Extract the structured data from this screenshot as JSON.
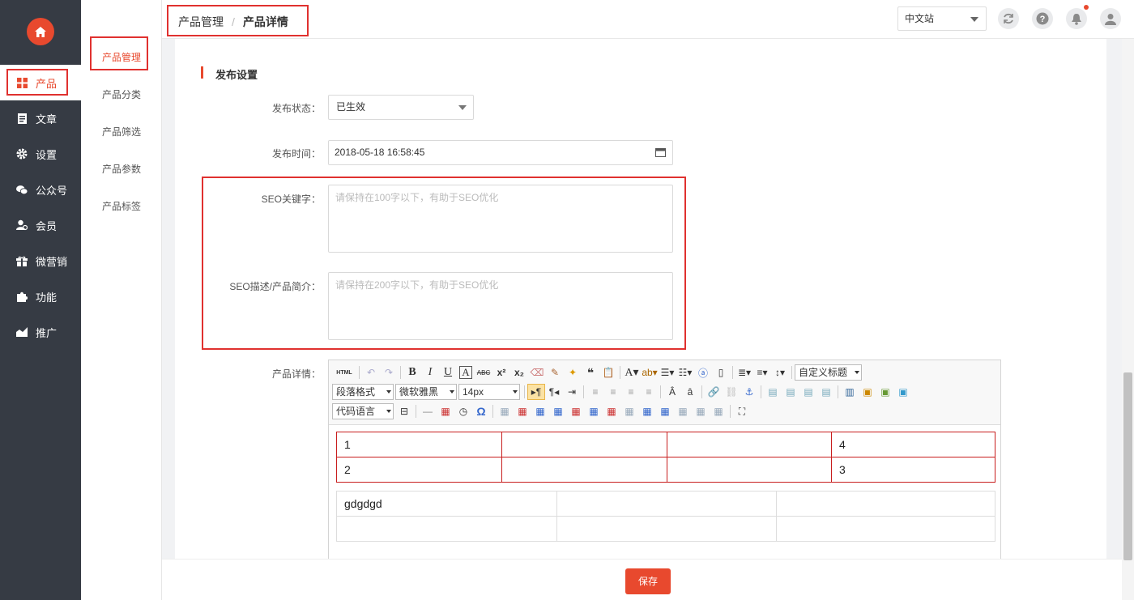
{
  "sidebar": {
    "items": [
      {
        "label": "产品",
        "icon": "grid-icon",
        "active": true
      },
      {
        "label": "文章",
        "icon": "document-icon"
      },
      {
        "label": "设置",
        "icon": "gear-icon"
      },
      {
        "label": "公众号",
        "icon": "wechat-icon"
      },
      {
        "label": "会员",
        "icon": "user-icon"
      },
      {
        "label": "微营销",
        "icon": "gift-icon"
      },
      {
        "label": "功能",
        "icon": "puzzle-icon"
      },
      {
        "label": "推广",
        "icon": "chart-icon"
      }
    ]
  },
  "subnav": {
    "items": [
      {
        "label": "产品管理",
        "active": true
      },
      {
        "label": "产品分类"
      },
      {
        "label": "产品筛选"
      },
      {
        "label": "产品参数"
      },
      {
        "label": "产品标签"
      }
    ]
  },
  "topbar": {
    "breadcrumb_root": "产品管理",
    "breadcrumb_sep": "/",
    "breadcrumb_current": "产品详情",
    "language": "中文站"
  },
  "form": {
    "section_title": "发布设置",
    "status_label": "发布状态：",
    "status_value": "已生效",
    "time_label": "发布时间：",
    "time_value": "2018-05-18 16:58:45",
    "seo_keywords_label": "SEO关键字：",
    "seo_keywords_placeholder": "请保持在100字以下，有助于SEO优化",
    "seo_desc_label": "SEO描述/产品简介：",
    "seo_desc_placeholder": "请保持在200字以下，有助于SEO优化",
    "detail_label": "产品详情："
  },
  "editor": {
    "toolbar": {
      "html": "HTML",
      "custom_title": "自定义标题",
      "paragraph": "段落格式",
      "font": "微软雅黑",
      "size": "14px",
      "code_lang": "代码语言"
    },
    "table1": [
      [
        "1",
        "",
        "",
        "4"
      ],
      [
        "2",
        "",
        "",
        "3"
      ]
    ],
    "table2": [
      [
        "gdgdgd",
        "",
        ""
      ],
      [
        "",
        "",
        ""
      ]
    ]
  },
  "actions": {
    "save": "保存"
  },
  "colors": {
    "accent": "#e8492e",
    "sidebar": "#363b44"
  }
}
